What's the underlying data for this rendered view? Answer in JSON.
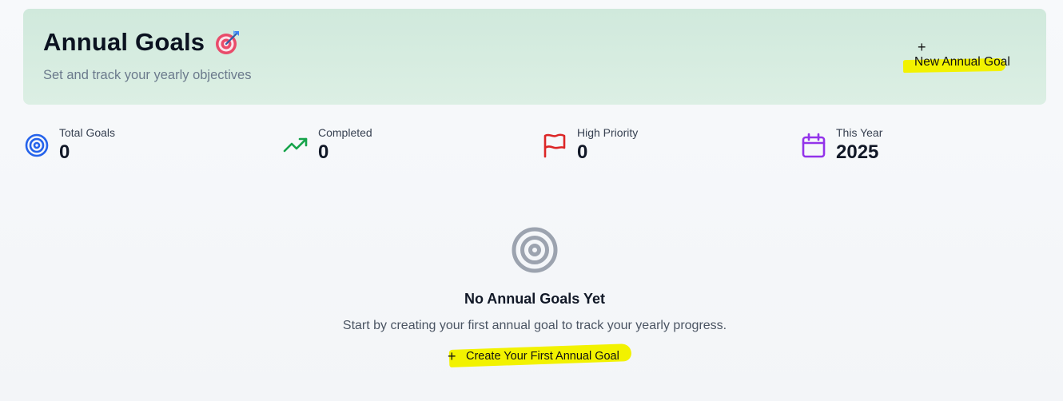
{
  "header": {
    "title": "Annual Goals",
    "title_emoji": "target-dart-icon",
    "subtitle": "Set and track your yearly objectives",
    "new_goal_button": {
      "icon": "+",
      "label": "New Annual Goal"
    }
  },
  "stats": [
    {
      "label": "Total Goals",
      "value": "0",
      "icon": "target-icon",
      "color": "#2563eb"
    },
    {
      "label": "Completed",
      "value": "0",
      "icon": "trending-up-icon",
      "color": "#16a34a"
    },
    {
      "label": "High Priority",
      "value": "0",
      "icon": "flag-icon",
      "color": "#dc2626"
    },
    {
      "label": "This Year",
      "value": "2025",
      "icon": "calendar-icon",
      "color": "#9333ea"
    }
  ],
  "empty_state": {
    "icon": "target-icon",
    "title": "No Annual Goals Yet",
    "description": "Start by creating your first annual goal to track your yearly progress.",
    "create_button": {
      "icon": "+",
      "label": "Create Your First Annual Goal"
    }
  },
  "colors": {
    "header_bg": "#d5ecdf",
    "highlight": "#f2f200",
    "empty_icon": "#9ca3af"
  }
}
